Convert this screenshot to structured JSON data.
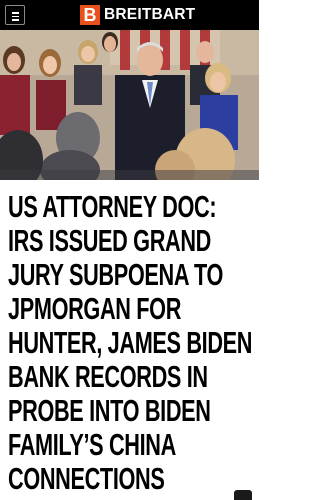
{
  "header": {
    "menu_icon": "hamburger-icon",
    "logo_letter": "B",
    "logo_text": "BREITBART",
    "brand_color": "#e8501c"
  },
  "hero": {
    "image": "photo"
  },
  "article": {
    "headline": "US ATTORNEY DOC: IRS ISSUED GRAND JURY SUBPOENA TO JPMORGAN FOR HUNTER, JAMES BIDEN BANK RECORDS IN PROBE INTO BIDEN FAMILY’S CHINA CONNECTIONS"
  }
}
